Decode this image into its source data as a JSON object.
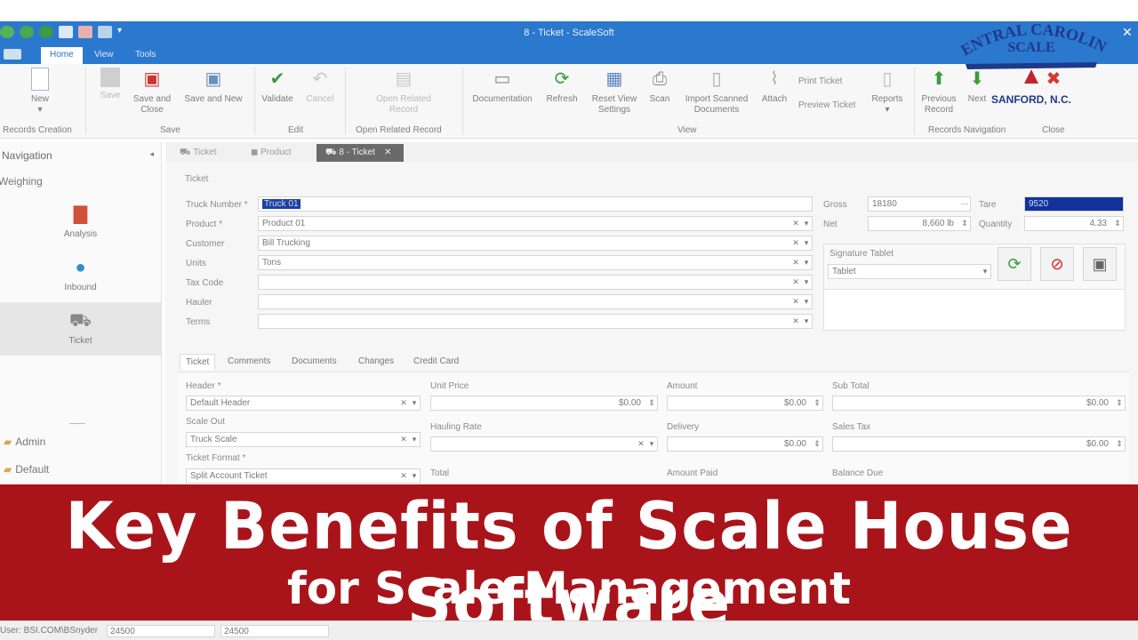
{
  "window": {
    "title": "8 - Ticket - ScaleSoft"
  },
  "ribbon_tabs": [
    "Home",
    "View",
    "Tools"
  ],
  "ribbon": {
    "new": "New",
    "save": "Save",
    "save_close": [
      "Save and",
      "Close"
    ],
    "save_new": "Save and New",
    "validate": "Validate",
    "cancel": "Cancel",
    "open_related": [
      "Open Related",
      "Record"
    ],
    "documentation": "Documentation",
    "refresh": "Refresh",
    "reset_view": [
      "Reset View",
      "Settings"
    ],
    "scan": "Scan",
    "import_scanned": [
      "Import Scanned",
      "Documents"
    ],
    "attach": "Attach",
    "print_ticket": "Print Ticket",
    "preview_ticket": "Preview Ticket",
    "reports": "Reports",
    "previous_record": [
      "Previous",
      "Record"
    ],
    "next": "Next",
    "groups": [
      "Records Creation",
      "Save",
      "Edit",
      "Open Related Record",
      "View",
      "Records Navigation",
      "Close"
    ]
  },
  "nav": {
    "title": "Navigation",
    "section": "Weighing",
    "items": [
      "Analysis",
      "Inbound",
      "Ticket"
    ],
    "links": [
      "Admin",
      "Default"
    ]
  },
  "doc_tabs": [
    "Ticket",
    "Product",
    "8 - Ticket"
  ],
  "ticket": {
    "group": "Ticket",
    "labels": [
      "Truck Number *",
      "Product *",
      "Customer",
      "Units",
      "Tax Code",
      "Hauler",
      "Terms"
    ],
    "values": [
      "Truck 01",
      "Product 01",
      "Bill Trucking",
      "Tons",
      "",
      "",
      ""
    ],
    "gross_label": "Gross",
    "gross": "18180",
    "net_label": "Net",
    "net": "8,660 lb",
    "tare_label": "Tare",
    "tare": "9520",
    "quantity_label": "Quantity",
    "quantity": "4.33",
    "signature_label": "Signature Tablet",
    "signature_value": "Tablet"
  },
  "sub_tabs": [
    "Ticket",
    "Comments",
    "Documents",
    "Changes",
    "Credit Card"
  ],
  "sub_form": {
    "header_label": "Header *",
    "header_value": "Default Header",
    "scale_out_label": "Scale Out",
    "scale_out_value": "Truck Scale",
    "ticket_format_label": "Ticket Format *",
    "ticket_format_value": "Split Account Ticket",
    "unit_price_label": "Unit Price",
    "unit_price": "$0.00",
    "amount_label": "Amount",
    "amount": "$0.00",
    "sub_total_label": "Sub Total",
    "sub_total": "$0.00",
    "hauling_rate_label": "Hauling Rate",
    "delivery_label": "Delivery",
    "delivery": "$0.00",
    "sales_tax_label": "Sales Tax",
    "sales_tax": "$0.00",
    "total_label": "Total",
    "amount_paid_label": "Amount Paid",
    "balance_due_label": "Balance Due"
  },
  "banner": {
    "title": "Key Benefits of Scale House Software",
    "subtitle": "for Scale Management"
  },
  "status": {
    "user": "User: BSI.COM\\BSnyder",
    "val1": "24500",
    "val2": "24500"
  },
  "logo": {
    "line1": "CENTRAL CAROLINA",
    "line2": "SCALE",
    "line3": "SANFORD, N.C."
  },
  "colors": {
    "title_bar": "#2b78cf",
    "banner": "#a8141a",
    "logo": "#1f3a8a",
    "logo_red": "#c0272d"
  }
}
